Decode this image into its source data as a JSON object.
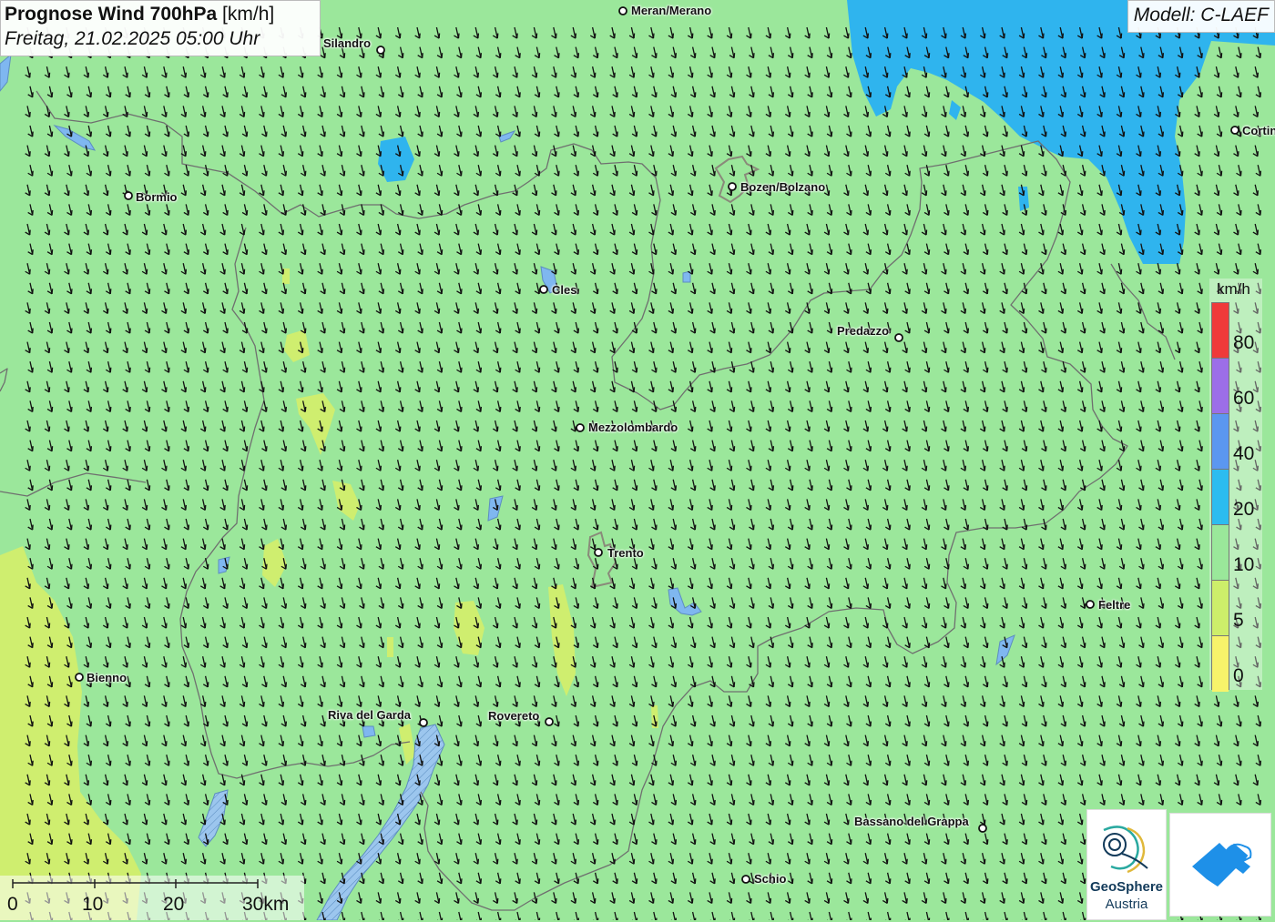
{
  "title": {
    "main_bold": "Prognose Wind 700hPa",
    "main_unit": " [km/h]",
    "datetime": "Freitag, 21.02.2025 05:00 Uhr"
  },
  "model": "Modell: C-LAEF",
  "cities": [
    {
      "name": "Meran/Merano"
    },
    {
      "name": "Silandro"
    },
    {
      "name": "Bormio"
    },
    {
      "name": "Bozen/Bolzano"
    },
    {
      "name": "Cortina"
    },
    {
      "name": "Cles"
    },
    {
      "name": "Predazzo"
    },
    {
      "name": "Mezzolombardo"
    },
    {
      "name": "Trento"
    },
    {
      "name": "Feltre"
    },
    {
      "name": "Bienno"
    },
    {
      "name": "Riva del Garda"
    },
    {
      "name": "Rovereto"
    },
    {
      "name": "Bassano del Grappa"
    },
    {
      "name": "Schio"
    }
  ],
  "legend": {
    "unit": "km/h",
    "levels": [
      {
        "label": "80",
        "color": "#ef3a3a"
      },
      {
        "label": "60",
        "color": "#9c6ee8"
      },
      {
        "label": "40",
        "color": "#5b97f0"
      },
      {
        "label": "20",
        "color": "#2cbcf0"
      },
      {
        "label": "10",
        "color": "#9ae89a"
      },
      {
        "label": "5",
        "color": "#cdee6a"
      },
      {
        "label": "0",
        "color": "#f7f36a"
      }
    ]
  },
  "scale_bar": {
    "labels": [
      "0",
      "10",
      "20",
      "30km"
    ]
  },
  "logos": {
    "geosphere_name": "GeoSphere",
    "geosphere_sub": "Austria",
    "app_icon": "weather-app-icon"
  },
  "colors": {
    "base_field": "#9be79b",
    "fast_wind": "#2fb4ee",
    "slow_wind": "#cfee6f",
    "lake": "#7fb7f0"
  }
}
